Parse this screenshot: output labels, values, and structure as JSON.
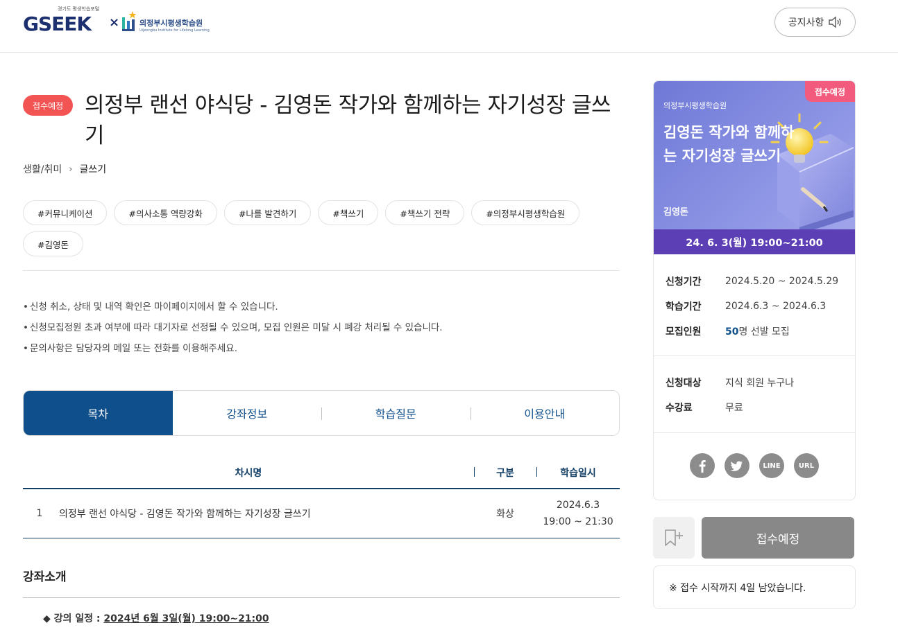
{
  "header": {
    "logo_sub": "경기도 평생학습포털",
    "logo_main": "GSEEK",
    "logo_x": "×",
    "inst_name": "의정부시평생학습원",
    "inst_en": "Uijeongbu Institute for Lifelong Learning",
    "notice_label": "공지사항"
  },
  "course": {
    "status": "접수예정",
    "title": "의정부 랜선 야식당 - 김영돈 작가와 함께하는 자기성장 글쓰기",
    "breadcrumb": [
      "생활/취미",
      "글쓰기"
    ],
    "tags": [
      "#커뮤니케이션",
      "#의사소통 역량강화",
      "#나를 발견하기",
      "#책쓰기",
      "#책쓰기 전략",
      "#의정부시평생학습원",
      "#김영돈"
    ],
    "notices": [
      "신청 취소, 상태 및 내역 확인은 마이페이지에서 할 수 있습니다.",
      "신청모집정원 초과 여부에 따라 대기자로 선정될 수 있으며, 모집 인원은 미달 시 폐강 처리될 수 있습니다.",
      "문의사항은 담당자의 메일 또는 전화를 이용해주세요."
    ]
  },
  "tabs": [
    "목차",
    "강좌정보",
    "학습질문",
    "이용안내"
  ],
  "table": {
    "headers": [
      "차시명",
      "구분",
      "학습일시"
    ],
    "rows": [
      {
        "num": "1",
        "name": "의정부 랜선 야식당 - 김영돈 작가와 함께하는 자기성장 글쓰기",
        "type": "화상",
        "date": "2024.6.3",
        "time": "19:00 ~ 21:30"
      }
    ]
  },
  "intro": {
    "title": "강좌소개",
    "schedule_label": "◆ 강의 일정 : ",
    "schedule_value": "2024년 6월 3일(월) 19:00~21:00"
  },
  "card": {
    "badge": "접수예정",
    "inst": "의정부시평생학습원",
    "banner_title": "김영돈 작가와 함께하는 자기성장 글쓰기",
    "author": "김영돈",
    "date": "24. 6. 3(월) 19:00~21:00",
    "info": [
      {
        "k": "신청기간",
        "v": "2024.5.20 ~ 2024.5.29"
      },
      {
        "k": "학습기간",
        "v": "2024.6.3 ~ 2024.6.3"
      },
      {
        "k": "모집인원",
        "v_num": "50",
        "v_rest": "명 선발 모집"
      }
    ],
    "info2": [
      {
        "k": "신청대상",
        "v": "지식 회원 누구나"
      },
      {
        "k": "수강료",
        "v": "무료"
      }
    ],
    "share": {
      "line": "LINE",
      "url": "URL"
    }
  },
  "actions": {
    "apply_label": "접수예정",
    "remain_text": "※ 접수 시작까지 4일 남았습니다."
  },
  "colors": {
    "primary": "#0e4f8c",
    "status_red": "#f25454",
    "banner_purple": "#5d3fb5",
    "apply_gray": "#888888"
  }
}
